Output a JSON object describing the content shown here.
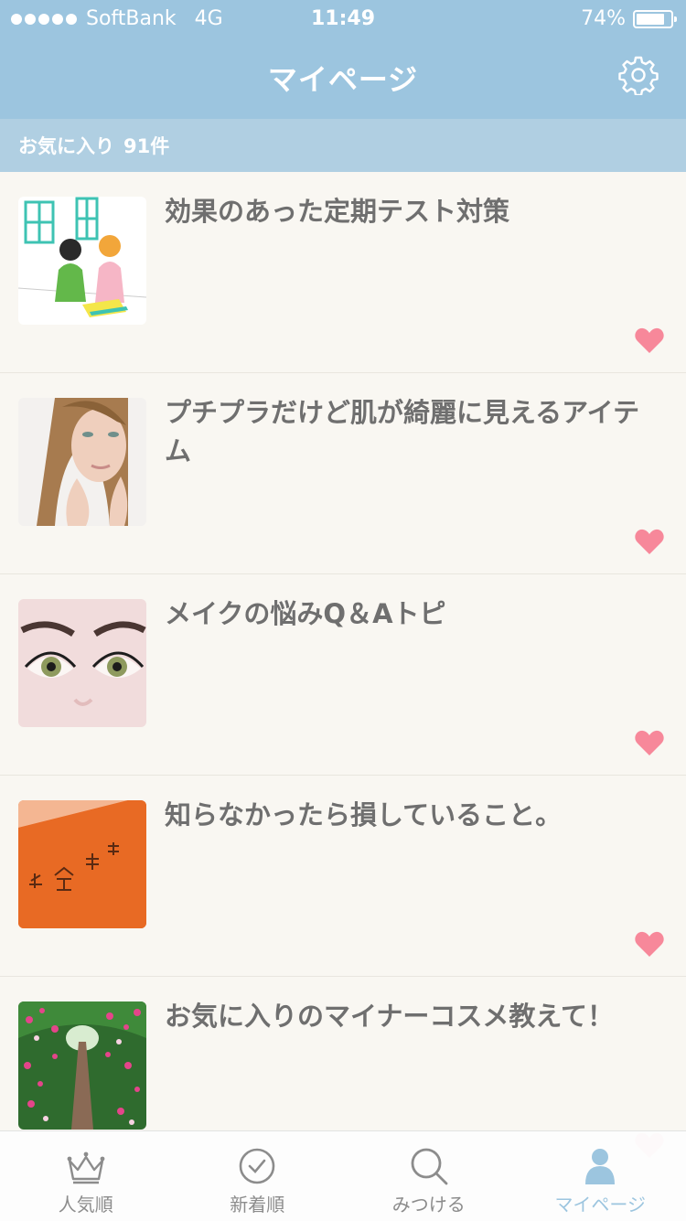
{
  "status_bar": {
    "carrier": "SoftBank",
    "network": "4G",
    "time": "11:49",
    "battery": "74%"
  },
  "nav": {
    "title": "マイページ",
    "settings_icon": "gear-icon"
  },
  "favorites_header": {
    "label": "お気に入り",
    "count": "91件"
  },
  "items": [
    {
      "title": "効果のあった定期テスト対策",
      "thumb": "study-illustration"
    },
    {
      "title": "プチプラだけど肌が綺麗に見えるアイテム",
      "thumb": "woman-face-photo"
    },
    {
      "title": "メイクの悩みQ＆Aトピ",
      "thumb": "eyes-closeup-photo"
    },
    {
      "title": "知らなかったら損していること。",
      "thumb": "pension-book-photo"
    },
    {
      "title": "お気に入りのマイナーコスメ教えて！",
      "thumb": "rose-garden-photo"
    }
  ],
  "tabs": [
    {
      "label": "人気順",
      "icon": "crown-icon"
    },
    {
      "label": "新着順",
      "icon": "clock-icon"
    },
    {
      "label": "みつける",
      "icon": "search-icon"
    },
    {
      "label": "マイページ",
      "icon": "user-icon"
    }
  ],
  "colors": {
    "header_bg": "#9cc5df",
    "subheader_bg": "#b0cfe2",
    "heart": "#f7889a",
    "active_tab": "#9cc5df",
    "title_text": "#6f6f6f"
  }
}
